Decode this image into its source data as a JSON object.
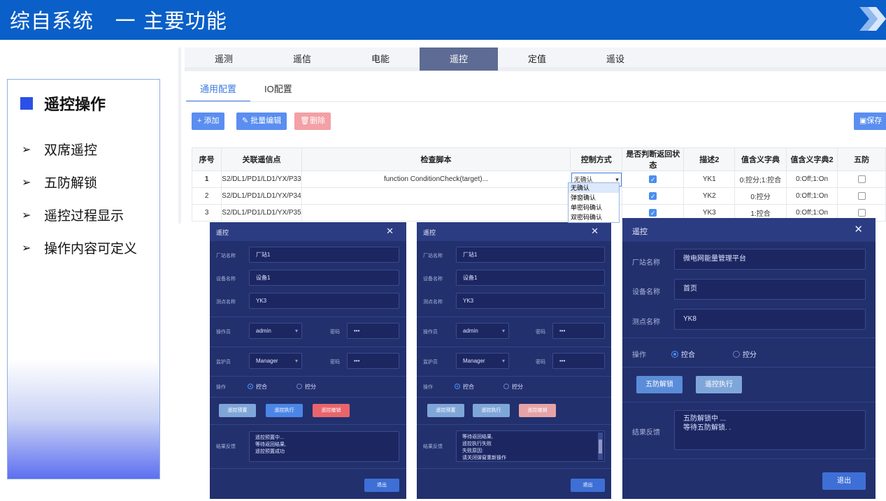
{
  "header": {
    "title": "综自系统   一 主要功能"
  },
  "features": {
    "title": "遥控操作",
    "items": [
      "双席遥控",
      "五防解锁",
      "遥控过程显示",
      "操作内容可定义"
    ]
  },
  "config": {
    "tabs": [
      "遥测",
      "遥信",
      "电能",
      "遥控",
      "定值",
      "遥设"
    ],
    "active_tab": "遥控",
    "subtabs": [
      "通用配置",
      "IO配置"
    ],
    "buttons": {
      "add": "+ 添加",
      "batch": "批量编辑",
      "delete": "删除",
      "save": "保存"
    },
    "columns": [
      "序号",
      "关联遥信点",
      "检查脚本",
      "控制方式",
      "是否判断返回状态",
      "描述2",
      "值含义字典",
      "值含义字典2",
      "五防"
    ],
    "rows": [
      {
        "no": "1",
        "point": "S2/DL1/PD1/LD1/YX/P33",
        "script": "function ConditionCheck(target)...",
        "mode": "无确认",
        "check": true,
        "desc": "YK1",
        "dict": "0:控分;1:控合",
        "dict2": "0:Off;1:On",
        "wf": false
      },
      {
        "no": "2",
        "point": "S2/DL1/PD1/LD1/YX/P34",
        "script": "",
        "mode": "",
        "check": true,
        "desc": "YK2",
        "dict": "0:控分",
        "dict2": "0:Off;1:On",
        "wf": false
      },
      {
        "no": "3",
        "point": "S2/DL1/PD1/LD1/YX/P35",
        "script": "",
        "mode": "",
        "check": true,
        "desc": "YK3",
        "dict": "1:控合",
        "dict2": "0:Off;1:On",
        "wf": false
      }
    ],
    "mode_options": [
      "无确认",
      "弹窗确认",
      "单密码确认",
      "双密码确认"
    ]
  },
  "dialog1": {
    "title": "遥控",
    "labels": {
      "station": "厂站名称",
      "device": "设备名称",
      "point": "测点名称",
      "operator": "操作员",
      "guardian": "监护员",
      "password": "密码",
      "op": "操作",
      "feedback": "结果反馈"
    },
    "station": "厂站1",
    "device": "设备1",
    "point": "YK3",
    "operator": "admin",
    "operator_pwd": "•••",
    "guardian": "Manager",
    "guardian_pwd": "•••",
    "op_on": "控合",
    "op_off": "控分",
    "btn_preset": "遥控预置",
    "btn_exec": "遥控执行",
    "btn_cancel": "遥控撤销",
    "feedback": [
      "遥控预置中...",
      "等待返回结果,",
      "遥控预置成功"
    ],
    "exit": "退出"
  },
  "dialog2": {
    "title": "遥控",
    "labels": {
      "station": "厂站名称",
      "device": "设备名称",
      "point": "测点名称",
      "operator": "操作员",
      "guardian": "监护员",
      "password": "密码",
      "op": "操作",
      "feedback": "结果反馈"
    },
    "station": "厂站1",
    "device": "设备1",
    "point": "YK3",
    "operator": "admin",
    "operator_pwd": "•••",
    "guardian": "Manager",
    "guardian_pwd": "•••",
    "op_on": "控合",
    "op_off": "控分",
    "btn_preset": "遥控预置",
    "btn_exec": "遥控执行",
    "btn_cancel": "遥控撤销",
    "feedback": [
      "等待返回结果,",
      "遥控执行失败",
      "失败原因:",
      "请关闭弹窗重新操作"
    ],
    "exit": "退出"
  },
  "dialog3": {
    "title": "遥控",
    "labels": {
      "station": "厂站名称",
      "device": "设备名称",
      "point": "测点名称",
      "op": "操作",
      "feedback": "结果反馈"
    },
    "station": "微电网能量管理平台",
    "device": "首页",
    "point": "YK8",
    "op_on": "控合",
    "op_off": "控分",
    "btn_unlock": "五防解锁",
    "btn_exec": "遥控执行",
    "feedback": [
      "五防解锁中 ...",
      "等待五防解锁. ."
    ],
    "exit": "退出"
  }
}
